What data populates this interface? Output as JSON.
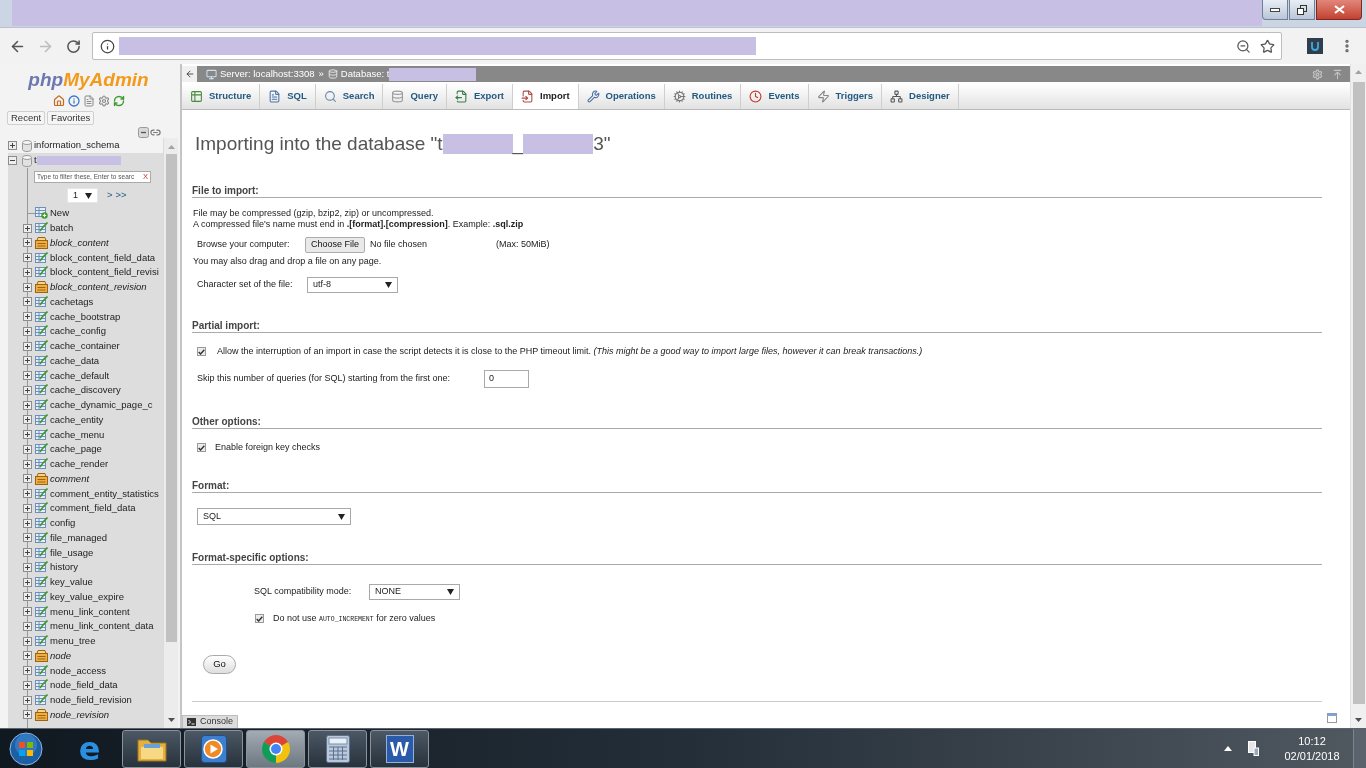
{
  "browser": {
    "tab_strip": {
      "redacted": true
    },
    "address_bar": {
      "redacted": true
    }
  },
  "sidebar": {
    "logo": [
      {
        "text": "php",
        "color": "#6c78af"
      },
      {
        "text": "MyAdmin",
        "color": "#f39a1a"
      }
    ],
    "quick_links": [
      "Recent",
      "Favorites"
    ],
    "databases": [
      {
        "name": "information_schema",
        "expanded": false,
        "selected": false
      },
      {
        "name": "t",
        "redacted": true,
        "expanded": true,
        "selected": true,
        "filter": {
          "placeholder": "Type to filter these, Enter to searc",
          "clear": "X"
        },
        "pager": {
          "page": "1",
          "next": ">",
          "last": ">>"
        },
        "children": [
          {
            "name": "New",
            "kind": "new"
          },
          {
            "name": "batch",
            "kind": "table"
          },
          {
            "name": "block_content",
            "kind": "view"
          },
          {
            "name": "block_content_field_data",
            "kind": "table"
          },
          {
            "name": "block_content_field_revisi",
            "kind": "table"
          },
          {
            "name": "block_content_revision",
            "kind": "view"
          },
          {
            "name": "cachetags",
            "kind": "table"
          },
          {
            "name": "cache_bootstrap",
            "kind": "table"
          },
          {
            "name": "cache_config",
            "kind": "table"
          },
          {
            "name": "cache_container",
            "kind": "table"
          },
          {
            "name": "cache_data",
            "kind": "table"
          },
          {
            "name": "cache_default",
            "kind": "table"
          },
          {
            "name": "cache_discovery",
            "kind": "table"
          },
          {
            "name": "cache_dynamic_page_c",
            "kind": "table"
          },
          {
            "name": "cache_entity",
            "kind": "table"
          },
          {
            "name": "cache_menu",
            "kind": "table"
          },
          {
            "name": "cache_page",
            "kind": "table"
          },
          {
            "name": "cache_render",
            "kind": "table"
          },
          {
            "name": "comment",
            "kind": "view"
          },
          {
            "name": "comment_entity_statistics",
            "kind": "table"
          },
          {
            "name": "comment_field_data",
            "kind": "table"
          },
          {
            "name": "config",
            "kind": "table"
          },
          {
            "name": "file_managed",
            "kind": "table"
          },
          {
            "name": "file_usage",
            "kind": "table"
          },
          {
            "name": "history",
            "kind": "table"
          },
          {
            "name": "key_value",
            "kind": "table"
          },
          {
            "name": "key_value_expire",
            "kind": "table"
          },
          {
            "name": "menu_link_content",
            "kind": "table"
          },
          {
            "name": "menu_link_content_data",
            "kind": "table"
          },
          {
            "name": "menu_tree",
            "kind": "table"
          },
          {
            "name": "node",
            "kind": "view"
          },
          {
            "name": "node_access",
            "kind": "table"
          },
          {
            "name": "node_field_data",
            "kind": "table"
          },
          {
            "name": "node_field_revision",
            "kind": "table"
          },
          {
            "name": "node_revision",
            "kind": "view"
          }
        ]
      }
    ]
  },
  "breadcrumb": {
    "items": [
      {
        "kind": "server",
        "label": "Server: localhost:3308",
        "redacted": false
      },
      {
        "kind": "database",
        "label": "Database: t",
        "redacted": true
      }
    ],
    "separator": "»"
  },
  "tabs": [
    {
      "label": "Structure",
      "selected": false
    },
    {
      "label": "SQL",
      "selected": false
    },
    {
      "label": "Search",
      "selected": false
    },
    {
      "label": "Query",
      "selected": false
    },
    {
      "label": "Export",
      "selected": false
    },
    {
      "label": "Import",
      "selected": true
    },
    {
      "label": "Operations",
      "selected": false
    },
    {
      "label": "Routines",
      "selected": false
    },
    {
      "label": "Events",
      "selected": false
    },
    {
      "label": "Triggers",
      "selected": false
    },
    {
      "label": "Designer",
      "selected": false
    }
  ],
  "heading": [
    {
      "kind": "text",
      "text": "Importing into the database \"t"
    },
    {
      "kind": "redacted"
    },
    {
      "kind": "text",
      "text": "_"
    },
    {
      "kind": "redacted"
    },
    {
      "kind": "text",
      "text": "3\""
    }
  ],
  "file_to_import": {
    "title": "File to import:",
    "notes": [
      "File may be compressed (gzip, bzip2, zip) or uncompressed.",
      "A compressed file's name must end in **.[format].[compression]**. Example: **.sql.zip**"
    ],
    "browse_label": "Browse your computer:",
    "choose_button": "Choose File",
    "file_status": "No file chosen",
    "max_size": "(Max: 50MiB)",
    "drag_note": "You may also drag and drop a file on any page.",
    "charset_label": "Character set of the file:",
    "charset_value": "utf-8"
  },
  "partial_import": {
    "title": "Partial import:",
    "allow_interrupt": {
      "checked": true,
      "label": "Allow the interruption of an import in case the script detects it is close to the PHP timeout limit. *(This might be a good way to import large files, however it can break transactions.)*"
    },
    "skip_label": "Skip this number of queries (for SQL) starting from the first one:",
    "skip_value": "0"
  },
  "other_options": {
    "title": "Other options:",
    "foreign_key_checks": {
      "checked": true,
      "label": "Enable foreign key checks"
    }
  },
  "format": {
    "title": "Format:",
    "value": "SQL"
  },
  "format_options": {
    "title": "Format-specific options:",
    "compat_label": "SQL compatibility mode:",
    "compat_value": "NONE",
    "no_auto_value": {
      "checked": true,
      "label_before": "Do not use",
      "code": "AUTO_INCREMENT",
      "label_after": "for zero values"
    }
  },
  "go_button": "Go",
  "console": "Console",
  "taskbar": {
    "apps": [
      {
        "kind": "ie",
        "letter": "e",
        "running": false,
        "selected": false
      },
      {
        "kind": "explorer",
        "running": true,
        "selected": false
      },
      {
        "kind": "media",
        "running": true,
        "selected": false
      },
      {
        "kind": "chrome",
        "running": true,
        "selected": true
      },
      {
        "kind": "calculator",
        "running": true,
        "selected": false
      },
      {
        "kind": "word",
        "letter": "W",
        "running": true,
        "selected": false
      }
    ],
    "clock": {
      "time": "10:12",
      "date": "02/01/2018"
    }
  }
}
